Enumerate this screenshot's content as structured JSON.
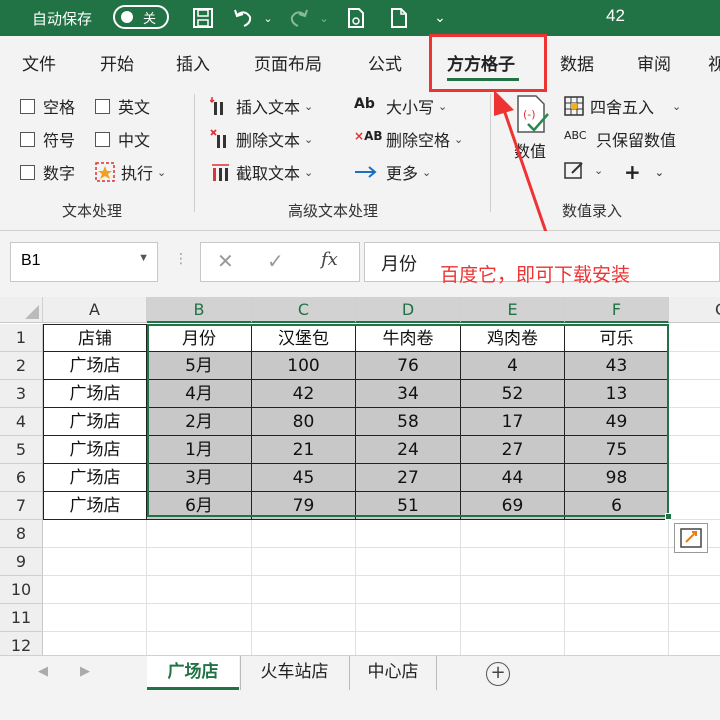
{
  "titlebar": {
    "autosave_label": "自动保存",
    "toggle_state": "关",
    "title_number": "42"
  },
  "tabs": [
    {
      "label": "文件"
    },
    {
      "label": "开始"
    },
    {
      "label": "插入"
    },
    {
      "label": "页面布局"
    },
    {
      "label": "公式"
    },
    {
      "label": "方方格子"
    },
    {
      "label": "数据"
    },
    {
      "label": "审阅"
    },
    {
      "label": "视"
    }
  ],
  "ribbon": {
    "text_group": {
      "label": "文本处理",
      "checkboxes": [
        "空格",
        "符号",
        "数字",
        "英文",
        "中文"
      ],
      "execute": "执行"
    },
    "advanced_group": {
      "label": "高级文本处理",
      "insert_text": "插入文本",
      "delete_text": "删除文本",
      "extract_text": "截取文本",
      "case": "大小写",
      "delete_space": "删除空格",
      "more": "更多"
    },
    "numeric_group": {
      "label": "数值录入",
      "big_button": "数值",
      "round": "四舍五入",
      "keep_values": "只保留数值",
      "abc": "ABC"
    }
  },
  "formula_bar": {
    "name_box": "B1",
    "fx": "fx",
    "value": "月份",
    "annotation": "百度它，即可下载安装"
  },
  "grid": {
    "columns": [
      "A",
      "B",
      "C",
      "D",
      "E",
      "F"
    ],
    "extra_column": "G",
    "rows": [
      "1",
      "2",
      "3",
      "4",
      "5",
      "6",
      "7",
      "8",
      "9",
      "10",
      "11",
      "12"
    ],
    "data": [
      [
        "店铺",
        "月份",
        "汉堡包",
        "牛肉卷",
        "鸡肉卷",
        "可乐"
      ],
      [
        "广场店",
        "5月",
        "100",
        "76",
        "4",
        "43"
      ],
      [
        "广场店",
        "4月",
        "42",
        "34",
        "52",
        "13"
      ],
      [
        "广场店",
        "2月",
        "80",
        "58",
        "17",
        "49"
      ],
      [
        "广场店",
        "1月",
        "21",
        "24",
        "27",
        "75"
      ],
      [
        "广场店",
        "3月",
        "45",
        "27",
        "44",
        "98"
      ],
      [
        "广场店",
        "6月",
        "79",
        "51",
        "69",
        "6"
      ]
    ]
  },
  "sheets": [
    "广场店",
    "火车站店",
    "中心店"
  ],
  "colors": {
    "accent": "#217346",
    "annotation": "#e33333"
  }
}
